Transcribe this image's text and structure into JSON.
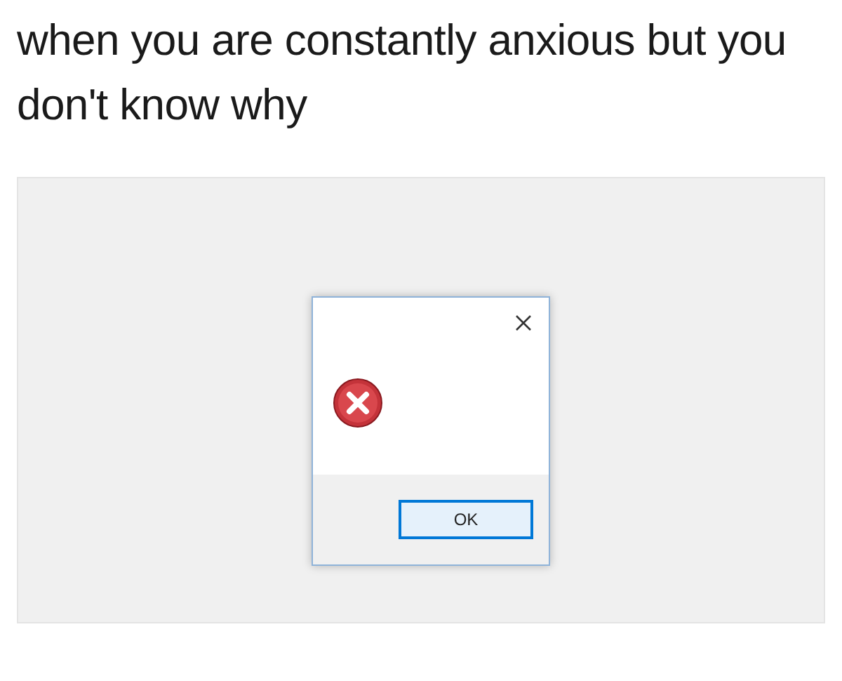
{
  "caption": "when you are constantly anxious but you don't know why",
  "dialog": {
    "button": "OK"
  }
}
